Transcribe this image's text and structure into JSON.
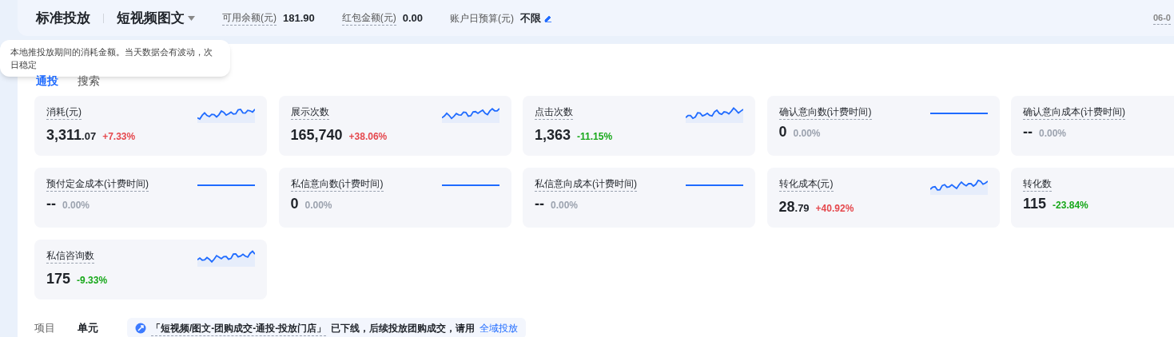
{
  "header": {
    "title": "标准投放",
    "mode": "短视频图文",
    "fields": [
      {
        "label": "可用余额(元)",
        "value": "181.90",
        "dotted": true,
        "editable": false
      },
      {
        "label": "红包金额(元)",
        "value": "0.00",
        "dotted": true,
        "editable": false
      },
      {
        "label": "账户日预算(元)",
        "value": "不限",
        "dotted": false,
        "editable": true
      }
    ],
    "date": "06-0"
  },
  "tabs": [
    {
      "label": "通投",
      "selected": true
    },
    {
      "label": "搜索",
      "selected": false
    }
  ],
  "tooltip": "本地推投放期间的消耗金额。当天数据会有波动，次日稳定",
  "metrics": [
    {
      "label": "消耗(元)",
      "value": "3,311",
      "decimals": ".07",
      "change": "+7.33%",
      "color": "#e5484d",
      "kind": "wave"
    },
    {
      "label": "展示次数",
      "value": "165,740",
      "change": "+38.06%",
      "color": "#e5484d",
      "kind": "wave"
    },
    {
      "label": "点击次数",
      "value": "1,363",
      "change": "-11.15%",
      "color": "#18a81a",
      "kind": "wave"
    },
    {
      "label": "确认意向数(计费时间)",
      "value": "0",
      "change": "0.00%",
      "color": "#9ca3af",
      "kind": "flat"
    },
    {
      "label": "确认意向成本(计费时间)",
      "value": "--",
      "change": "0.00%",
      "color": "#9ca3af",
      "kind": "plain"
    },
    {
      "label": "预付定金成本(计费时间)",
      "value": "--",
      "change": "0.00%",
      "color": "#9ca3af",
      "kind": "flat"
    },
    {
      "label": "私信意向数(计费时间)",
      "value": "0",
      "change": "0.00%",
      "color": "#9ca3af",
      "kind": "flat"
    },
    {
      "label": "私信意向成本(计费时间)",
      "value": "--",
      "change": "0.00%",
      "color": "#9ca3af",
      "kind": "flat"
    },
    {
      "label": "转化成本(元)",
      "value": "28",
      "decimals": ".79",
      "change": "+40.92%",
      "color": "#e5484d",
      "kind": "wave"
    },
    {
      "label": "转化数",
      "value": "115",
      "change": "-23.84%",
      "color": "#18a81a",
      "kind": "plain"
    },
    {
      "label": "私信咨询数",
      "value": "175",
      "change": "-9.33%",
      "color": "#18a81a",
      "kind": "wave"
    }
  ],
  "level_tabs": [
    {
      "label": "项目",
      "selected": false
    },
    {
      "label": "单元",
      "selected": true
    }
  ],
  "notice": {
    "quoted": "「短视频/图文-团购成交-通投-投放门店」",
    "text": "已下线，后续投放团购成交，请用",
    "link": "全域投放"
  }
}
